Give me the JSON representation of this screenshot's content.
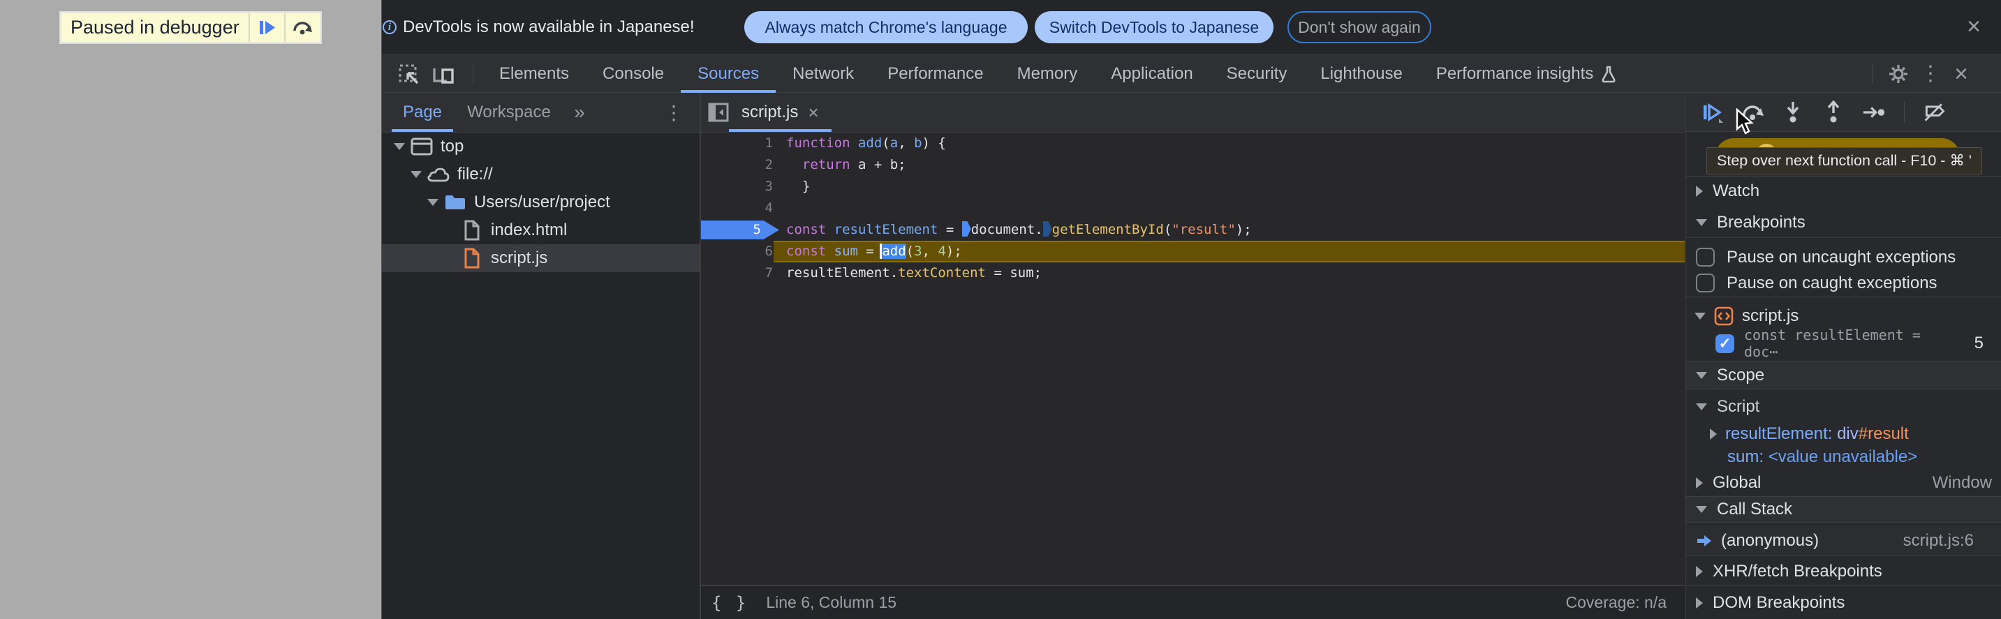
{
  "colors": {
    "accent": "#7cacf8",
    "pill_blue": "#a8c7fa",
    "breakpoint_blue": "#4e87f0",
    "exec_line": "#665004",
    "banner_yellow": "#fbfad3"
  },
  "paused_banner": {
    "label": "Paused in debugger",
    "icons": [
      "resume-icon",
      "step-over-icon"
    ]
  },
  "infobar": {
    "message": "DevTools is now available in Japanese!",
    "buttons": [
      {
        "label": "Always match Chrome's language",
        "style": "filled"
      },
      {
        "label": "Switch DevTools to Japanese",
        "style": "filled"
      },
      {
        "label": "Don't show again",
        "style": "outline"
      }
    ],
    "close_label": "×"
  },
  "main_toolbar": {
    "tabs": [
      {
        "label": "Elements"
      },
      {
        "label": "Console"
      },
      {
        "label": "Sources",
        "active": true
      },
      {
        "label": "Network"
      },
      {
        "label": "Performance"
      },
      {
        "label": "Memory"
      },
      {
        "label": "Application"
      },
      {
        "label": "Security"
      },
      {
        "label": "Lighthouse"
      },
      {
        "label": "Performance insights",
        "flask": true
      }
    ],
    "close_label": "×"
  },
  "navigator": {
    "tabs": [
      {
        "label": "Page",
        "active": true
      },
      {
        "label": "Workspace"
      }
    ],
    "more_tabs_glyph": "»",
    "tree": [
      {
        "label": "top",
        "icon": "frame",
        "chev": "down",
        "indent": 0
      },
      {
        "label": "file://",
        "icon": "cloud",
        "chev": "down",
        "indent": 1
      },
      {
        "label": "Users/user/project",
        "icon": "folder",
        "chev": "down",
        "indent": 2
      },
      {
        "label": "index.html",
        "icon": "file",
        "chev": null,
        "indent": 3
      },
      {
        "label": "script.js",
        "icon": "file-js",
        "chev": null,
        "indent": 3,
        "selected": true
      }
    ]
  },
  "editor": {
    "tab_label": "script.js",
    "tab_close": "×",
    "lines": [
      {
        "n": "1",
        "tokens": [
          {
            "c": "kw",
            "t": "function"
          },
          {
            "c": "pl",
            "t": " "
          },
          {
            "c": "def",
            "t": "add"
          },
          {
            "c": "pl",
            "t": "("
          },
          {
            "c": "def",
            "t": "a"
          },
          {
            "c": "pl",
            "t": ", "
          },
          {
            "c": "def",
            "t": "b"
          },
          {
            "c": "pl",
            "t": ") {"
          }
        ]
      },
      {
        "n": "2",
        "tokens": [
          {
            "c": "pl",
            "t": "  "
          },
          {
            "c": "kw",
            "t": "return"
          },
          {
            "c": "pl",
            "t": " a + b;"
          }
        ]
      },
      {
        "n": "3",
        "tokens": [
          {
            "c": "pl",
            "t": "  }"
          }
        ]
      },
      {
        "n": "4",
        "tokens": []
      },
      {
        "n": "5",
        "breakpoint": true,
        "tokens": [
          {
            "c": "kw",
            "t": "const"
          },
          {
            "c": "pl",
            "t": " "
          },
          {
            "c": "def",
            "t": "resultElement"
          },
          {
            "c": "pl",
            "t": " = "
          },
          {
            "c": "m1"
          },
          {
            "c": "pl",
            "t": "document."
          },
          {
            "c": "m2"
          },
          {
            "c": "gold",
            "t": "getElementById"
          },
          {
            "c": "pl",
            "t": "("
          },
          {
            "c": "str",
            "t": "\"result\""
          },
          {
            "c": "pl",
            "t": ");"
          }
        ]
      },
      {
        "n": "6",
        "exec": true,
        "tokens": [
          {
            "c": "kw",
            "t": "const"
          },
          {
            "c": "pl",
            "t": " "
          },
          {
            "c": "def2",
            "t": "sum"
          },
          {
            "c": "pl",
            "t": " = "
          },
          {
            "c": "sel",
            "t": "add"
          },
          {
            "c": "pl",
            "t": "("
          },
          {
            "c": "num",
            "t": "3"
          },
          {
            "c": "pl",
            "t": ", "
          },
          {
            "c": "num",
            "t": "4"
          },
          {
            "c": "pl",
            "t": ");"
          }
        ]
      },
      {
        "n": "7",
        "tokens": [
          {
            "c": "pl",
            "t": "resultElement."
          },
          {
            "c": "gold",
            "t": "textContent"
          },
          {
            "c": "pl",
            "t": " = sum;"
          }
        ]
      }
    ],
    "status_left": "Line 6, Column 15",
    "status_right": "Coverage: n/a",
    "braces_glyph": "{ }"
  },
  "debugger_sidebar": {
    "tooltip": "Step over next function call - F10 - ⌘ '",
    "toolbar_icons": [
      "resume-icon",
      "step-over-icon",
      "step-into-icon",
      "step-out-icon",
      "step-icon",
      "deactivate-breakpoints-icon"
    ],
    "watch": "Watch",
    "breakpoints": "Breakpoints",
    "pause_uncaught": "Pause on uncaught exceptions",
    "pause_caught": "Pause on caught exceptions",
    "bp_group_label": "script.js",
    "bp_entry_snippet": "const resultElement = doc⋯",
    "bp_entry_line": "5",
    "scope": "Scope",
    "scope_script": "Script",
    "var1_name": "resultElement",
    "var1_sep": ": ",
    "var1_node": "div",
    "var1_id": "#result",
    "var2_name": "sum",
    "var2_sep": ": ",
    "var2_value": "<value unavailable>",
    "global_label": "Global",
    "global_value": "Window",
    "callstack": "Call Stack",
    "frame_label": "(anonymous)",
    "frame_location": "script.js:6",
    "xhr": "XHR/fetch Breakpoints",
    "dom": "DOM Breakpoints"
  }
}
